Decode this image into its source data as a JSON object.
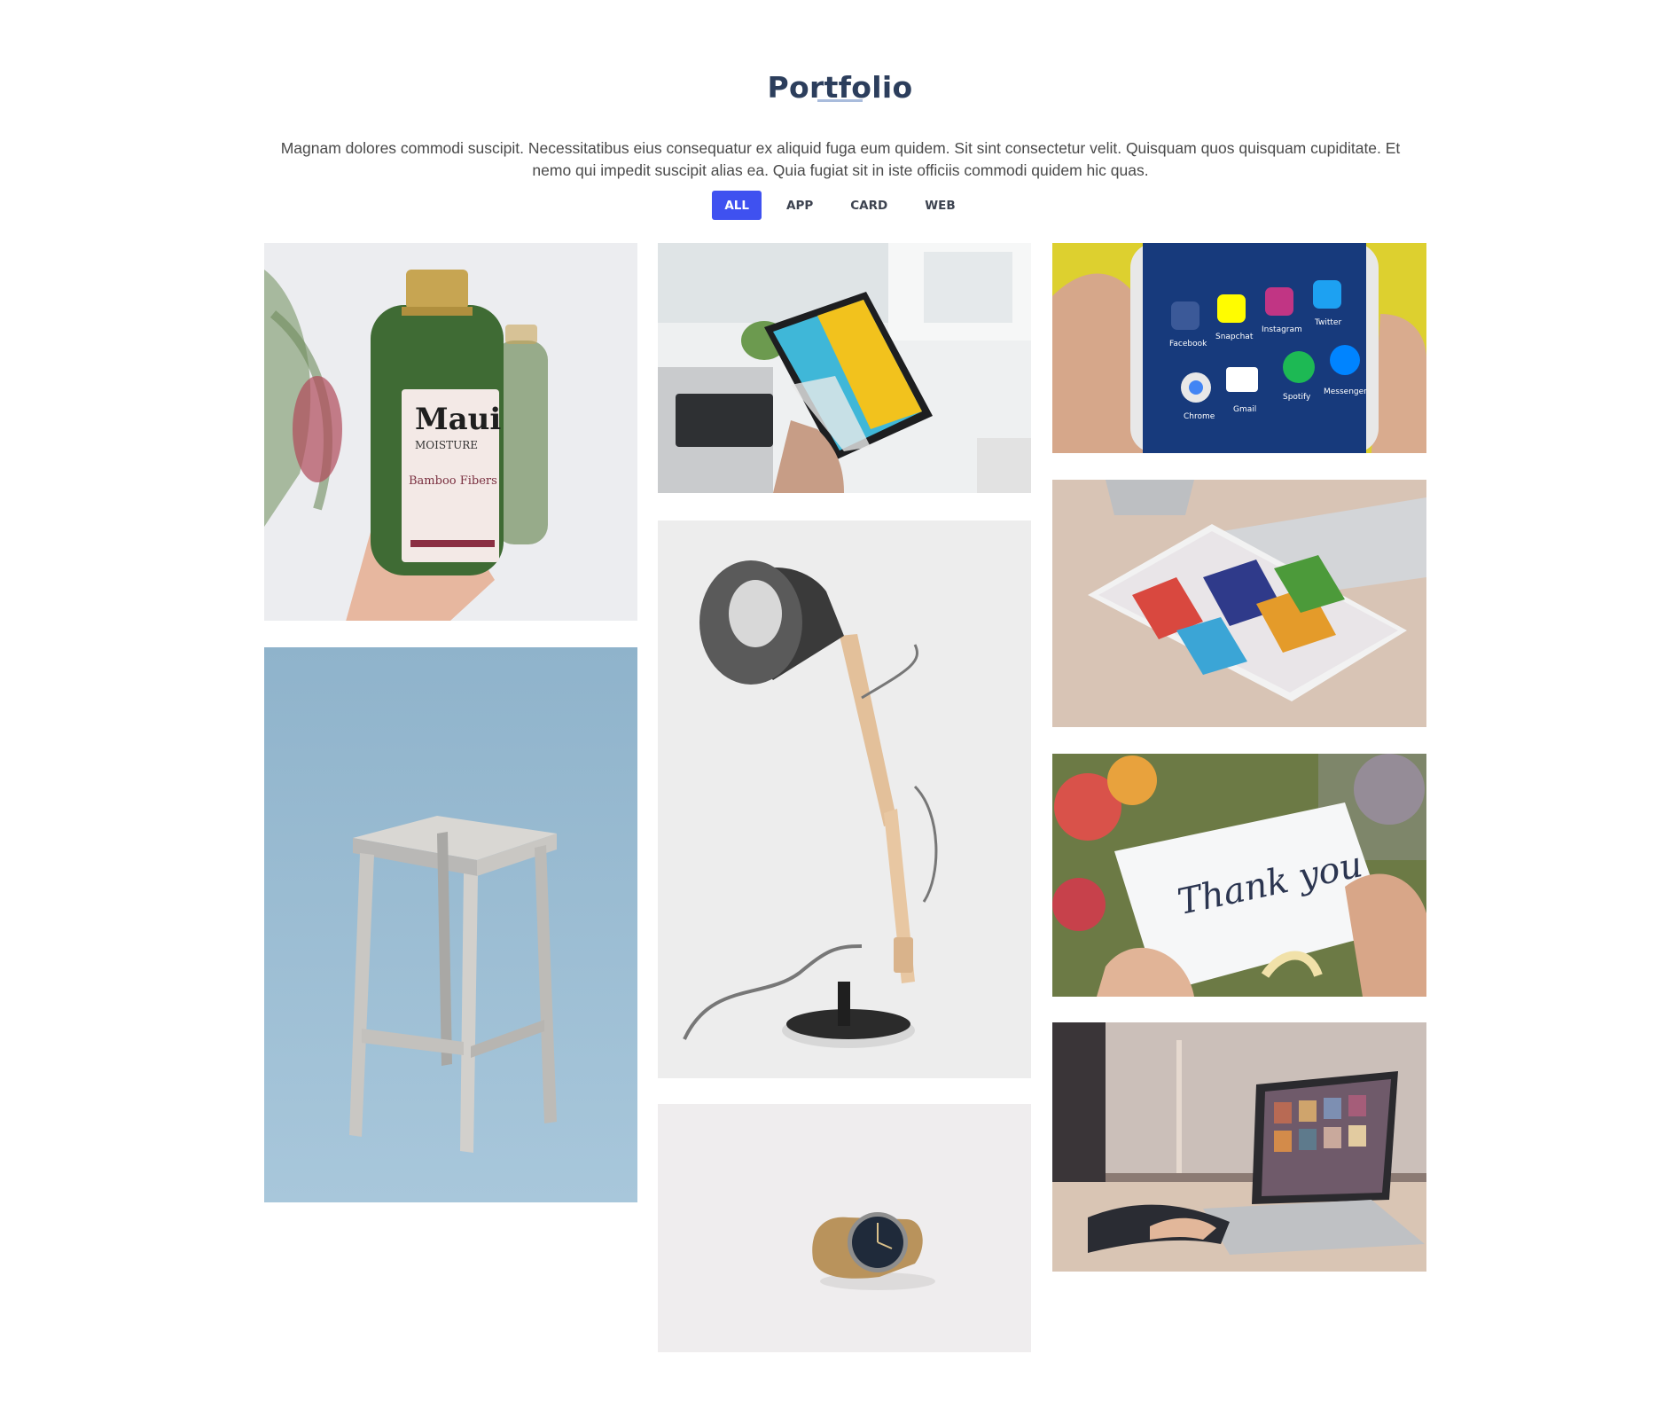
{
  "section": {
    "title": "Portfolio",
    "description": "Magnam dolores commodi suscipit. Necessitatibus eius consequatur ex aliquid fuga eum quidem. Sit sint consectetur velit. Quisquam quos quisquam cupiditate. Et nemo qui impedit suscipit alias ea. Quia fugiat sit in iste officiis commodi quidem hic quas."
  },
  "filters": {
    "active": "ALL",
    "items": [
      "ALL",
      "APP",
      "CARD",
      "WEB"
    ]
  },
  "portfolio": {
    "items": [
      {
        "subject": "shampoo-bottle",
        "bottle_brand": "Maui",
        "bottle_subtitle": "MOISTURE",
        "bottle_line": "Bamboo Fibers"
      },
      {
        "subject": "tablet-in-hand"
      },
      {
        "subject": "phone-social-apps",
        "apps": [
          "Facebook",
          "Snapchat",
          "Instagram",
          "Twitter",
          "Chrome",
          "Gmail",
          "Spotify",
          "Messenger"
        ]
      },
      {
        "subject": "ipad-app-store"
      },
      {
        "subject": "wooden-stool"
      },
      {
        "subject": "desk-lamp"
      },
      {
        "subject": "thank-you-card",
        "card_text": "Thank you"
      },
      {
        "subject": "wrist-watch"
      },
      {
        "subject": "laptop-typing"
      }
    ]
  },
  "colors": {
    "accent": "#3f51f0",
    "title": "#2c3e5c",
    "underline": "#a9bcdc"
  }
}
